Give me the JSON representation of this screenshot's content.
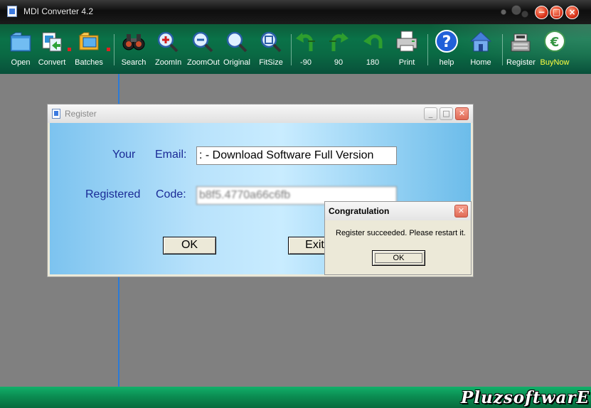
{
  "app": {
    "title": "MDI Converter 4.2"
  },
  "toolbar": {
    "open": "Open",
    "convert": "Convert",
    "batches": "Batches",
    "search": "Search",
    "zoomin": "ZoomIn",
    "zoomout": "ZoomOut",
    "original": "Original",
    "fitsize": "FitSize",
    "rot_neg90": "-90",
    "rot_90": "90",
    "rot_180": "180",
    "print": "Print",
    "help": "help",
    "home": "Home",
    "register": "Register",
    "buynow": "BuyNow"
  },
  "register_dialog": {
    "title": "Register",
    "your_label": "Your",
    "email_label": "Email:",
    "email_value": ": - Download Software Full Version",
    "registered_label": "Registered",
    "code_label": "Code:",
    "code_value": "b8f5.4770a66c6fb",
    "ok_label": "OK",
    "exit_label": "Exit"
  },
  "message_box": {
    "title": "Congratulation",
    "text": "Register succeeded. Please restart it.",
    "ok_label": "OK"
  },
  "watermark": "PluzsoftwarE",
  "colors": {
    "toolbar_bg": "#0a7248",
    "workspace": "#808080",
    "label_blue": "#1a2a96",
    "buynow_yellow": "#ffff3a"
  }
}
